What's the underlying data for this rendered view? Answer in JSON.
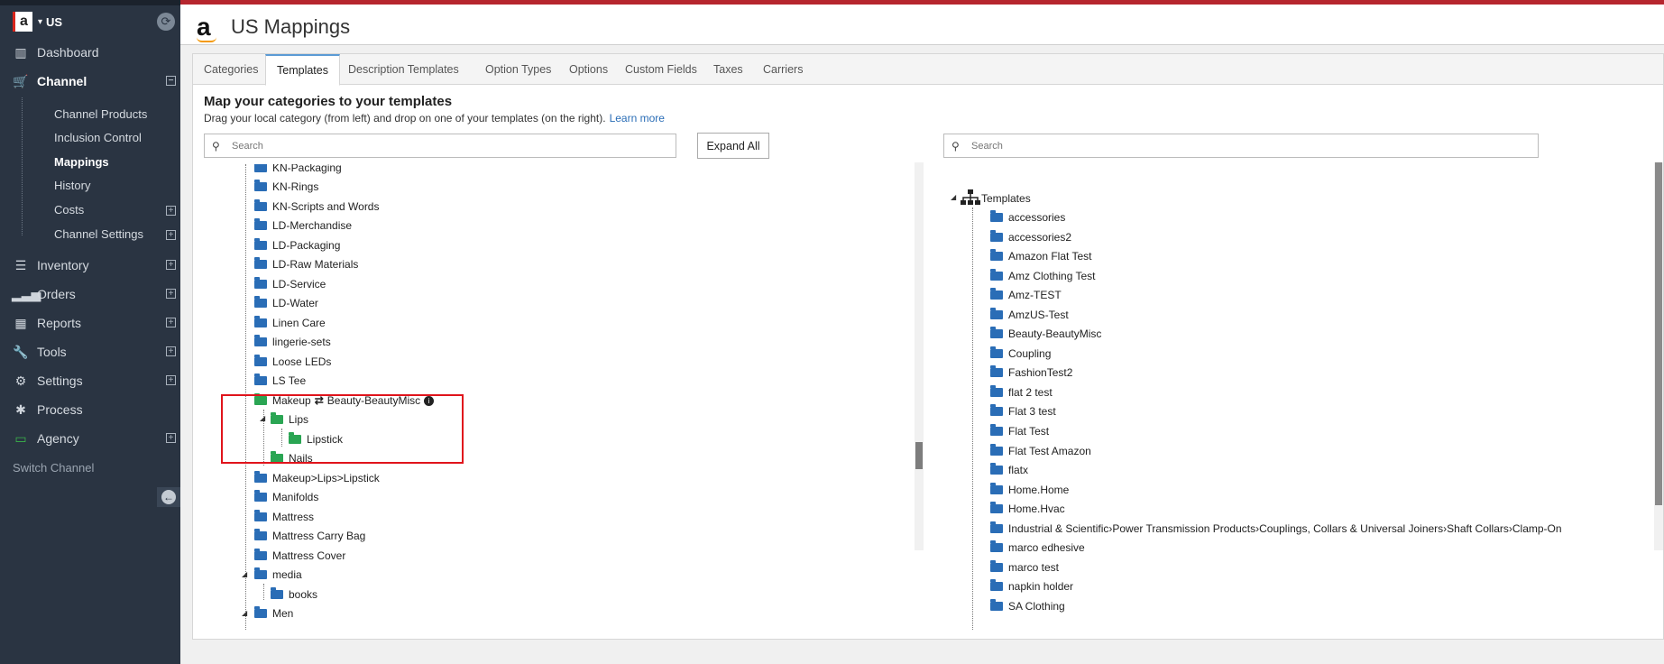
{
  "sidebar": {
    "region": "US",
    "items": [
      {
        "label": "Dashboard",
        "icon": "bar-chart-icon"
      },
      {
        "label": "Channel",
        "icon": "cart-icon"
      },
      {
        "label": "Inventory",
        "icon": "list-icon"
      },
      {
        "label": "Orders",
        "icon": "signal-icon"
      },
      {
        "label": "Reports",
        "icon": "excel-icon"
      },
      {
        "label": "Tools",
        "icon": "wrench-icon"
      },
      {
        "label": "Settings",
        "icon": "gear-icon"
      },
      {
        "label": "Process",
        "icon": "bug-icon"
      },
      {
        "label": "Agency",
        "icon": "monitor-icon"
      }
    ],
    "channel_sub": [
      "Channel Products",
      "Inclusion Control",
      "Mappings",
      "History",
      "Costs",
      "Channel Settings"
    ],
    "switch_channel": "Switch Channel"
  },
  "header": {
    "title": "US Mappings"
  },
  "tabs": [
    "Categories",
    "Templates",
    "Description Templates",
    "Option Types",
    "Options",
    "Custom Fields",
    "Taxes",
    "Carriers"
  ],
  "main": {
    "heading": "Map your categories to your templates",
    "subheading": "Drag your local category (from left) and drop on one of your templates (on the right).",
    "learn_more": "Learn more",
    "search_placeholder": "Search",
    "expand_all": "Expand All"
  },
  "left_tree": {
    "rows": [
      "KN-Packaging",
      "KN-Rings",
      "KN-Scripts and Words",
      "LD-Merchandise",
      "LD-Packaging",
      "LD-Raw Materials",
      "LD-Service",
      "LD-Water",
      "Linen Care",
      "lingerie-sets",
      "Loose LEDs",
      "LS Tee",
      "Makeup",
      "Lips",
      "Lipstick",
      "Nails",
      "Makeup>Lips>Lipstick",
      "Manifolds",
      "Mattress",
      "Mattress Carry Bag",
      "Mattress Cover",
      "media",
      "books",
      "Men"
    ],
    "mapping_target": "Beauty-BeautyMisc"
  },
  "right_tree": {
    "root": "Templates",
    "rows": [
      "accessories",
      "accessories2",
      "Amazon Flat Test",
      "Amz Clothing Test",
      "Amz-TEST",
      "AmzUS-Test",
      "Beauty-BeautyMisc",
      "Coupling",
      "FashionTest2",
      "flat 2 test",
      "Flat 3 test",
      "Flat Test",
      "Flat Test Amazon",
      "flatx",
      "Home.Home",
      "Home.Hvac",
      "Industrial & Scientific›Power Transmission Products›Couplings, Collars & Universal Joiners›Shaft Collars›Clamp-On",
      "marco edhesive",
      "marco test",
      "napkin holder",
      "SA Clothing"
    ]
  }
}
